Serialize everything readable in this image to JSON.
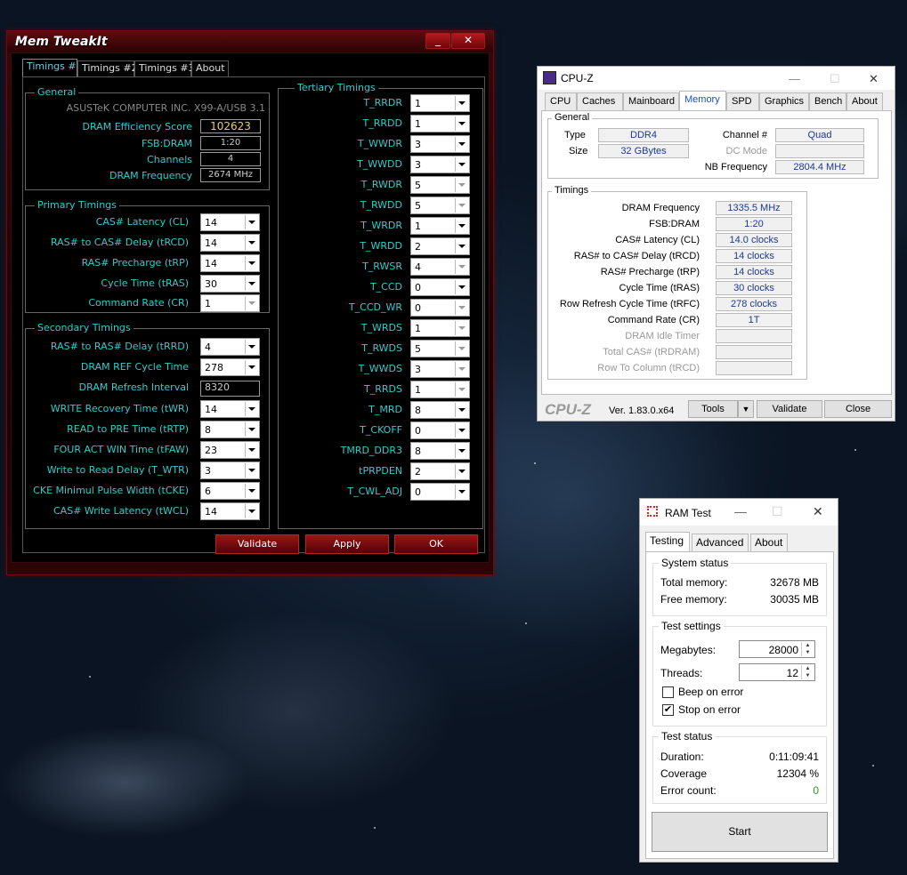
{
  "memtweakit": {
    "title": "Mem TweakIt",
    "min_label": "_",
    "close_label": "✕",
    "tabs": [
      "Timings #1",
      "Timings #2",
      "Timings #3",
      "About"
    ],
    "general": {
      "label": "General",
      "board": "ASUSTeK COMPUTER INC. X99-A/USB 3.1",
      "efficiency_label": "DRAM Efficiency Score",
      "efficiency_value": "102623",
      "fsb_label": "FSB:DRAM",
      "fsb_value": "1:20",
      "channels_label": "Channels",
      "channels_value": "4",
      "freq_label": "DRAM Frequency",
      "freq_value": "2674 MHz"
    },
    "primary": {
      "label": "Primary Timings",
      "rows": [
        {
          "label": "CAS# Latency (CL)",
          "value": "14"
        },
        {
          "label": "RAS# to CAS# Delay (tRCD)",
          "value": "14"
        },
        {
          "label": "RAS# Precharge (tRP)",
          "value": "14"
        },
        {
          "label": "Cycle Time (tRAS)",
          "value": "30"
        },
        {
          "label": "Command Rate (CR)",
          "value": "1"
        }
      ]
    },
    "secondary": {
      "label": "Secondary Timings",
      "rows": [
        {
          "label": "RAS# to RAS# Delay (tRRD)",
          "value": "4"
        },
        {
          "label": "DRAM REF Cycle Time",
          "value": "278"
        },
        {
          "label": "DRAM Refresh Interval",
          "value": "8320"
        },
        {
          "label": "WRITE Recovery Time (tWR)",
          "value": "14"
        },
        {
          "label": "READ to PRE Time (tRTP)",
          "value": "8"
        },
        {
          "label": "FOUR ACT WIN Time (tFAW)",
          "value": "23"
        },
        {
          "label": "Write to Read Delay (T_WTR)",
          "value": "3"
        },
        {
          "label": "CKE Minimul Pulse Width (tCKE)",
          "value": "6"
        },
        {
          "label": "CAS# Write Latency (tWCL)",
          "value": "14"
        }
      ]
    },
    "tertiary": {
      "label": "Tertiary Timings",
      "rows": [
        {
          "label": "T_RRDR",
          "value": "1"
        },
        {
          "label": "T_RRDD",
          "value": "1"
        },
        {
          "label": "T_WWDR",
          "value": "3"
        },
        {
          "label": "T_WWDD",
          "value": "3"
        },
        {
          "label": "T_RWDR",
          "value": "5"
        },
        {
          "label": "T_RWDD",
          "value": "5"
        },
        {
          "label": "T_WRDR",
          "value": "1"
        },
        {
          "label": "T_WRDD",
          "value": "2"
        },
        {
          "label": "T_RWSR",
          "value": "4"
        },
        {
          "label": "T_CCD",
          "value": "0"
        },
        {
          "label": "T_CCD_WR",
          "value": "0"
        },
        {
          "label": "T_WRDS",
          "value": "1"
        },
        {
          "label": "T_RWDS",
          "value": "5"
        },
        {
          "label": "T_WWDS",
          "value": "3"
        },
        {
          "label": "T_RRDS",
          "value": "1"
        },
        {
          "label": "T_MRD",
          "value": "8"
        },
        {
          "label": "T_CKOFF",
          "value": "0"
        },
        {
          "label": "TMRD_DDR3",
          "value": "8"
        },
        {
          "label": "tPRPDEN",
          "value": "2"
        },
        {
          "label": "T_CWL_ADJ",
          "value": "0"
        }
      ]
    },
    "buttons": {
      "validate": "Validate",
      "apply": "Apply",
      "ok": "OK"
    }
  },
  "cpuz": {
    "title": "CPU-Z",
    "tabs": [
      "CPU",
      "Caches",
      "Mainboard",
      "Memory",
      "SPD",
      "Graphics",
      "Bench",
      "About"
    ],
    "general": {
      "label": "General",
      "type_label": "Type",
      "type_value": "DDR4",
      "size_label": "Size",
      "size_value": "32 GBytes",
      "channel_label": "Channel #",
      "channel_value": "Quad",
      "dcmode_label": "DC Mode",
      "dcmode_value": "",
      "nb_label": "NB Frequency",
      "nb_value": "2804.4 MHz"
    },
    "timings": {
      "label": "Timings",
      "rows": [
        {
          "label": "DRAM Frequency",
          "value": "1335.5 MHz"
        },
        {
          "label": "FSB:DRAM",
          "value": "1:20"
        },
        {
          "label": "CAS# Latency (CL)",
          "value": "14.0 clocks"
        },
        {
          "label": "RAS# to CAS# Delay (tRCD)",
          "value": "14 clocks"
        },
        {
          "label": "RAS# Precharge (tRP)",
          "value": "14 clocks"
        },
        {
          "label": "Cycle Time (tRAS)",
          "value": "30 clocks"
        },
        {
          "label": "Row Refresh Cycle Time (tRFC)",
          "value": "278 clocks"
        },
        {
          "label": "Command Rate (CR)",
          "value": "1T"
        },
        {
          "label": "DRAM Idle Timer",
          "value": ""
        },
        {
          "label": "Total CAS# (tRDRAM)",
          "value": ""
        },
        {
          "label": "Row To Column (tRCD)",
          "value": ""
        }
      ]
    },
    "logo": "CPU-Z",
    "version": "Ver. 1.83.0.x64",
    "tools": "Tools",
    "validate": "Validate",
    "close": "Close"
  },
  "ramtest": {
    "title": "RAM Test",
    "tabs": [
      "Testing",
      "Advanced",
      "About"
    ],
    "system": {
      "label": "System status",
      "total_label": "Total memory:",
      "total_value": "32678 MB",
      "free_label": "Free memory:",
      "free_value": "30035 MB"
    },
    "settings": {
      "label": "Test settings",
      "mb_label": "Megabytes:",
      "mb_value": "28000",
      "threads_label": "Threads:",
      "threads_value": "12",
      "beep_label": "Beep on error",
      "beep_checked": false,
      "stop_label": "Stop on error",
      "stop_checked": true
    },
    "status": {
      "label": "Test status",
      "duration_label": "Duration:",
      "duration_value": "0:11:09:41",
      "coverage_label": "Coverage",
      "coverage_value": "12304 %",
      "errors_label": "Error count:",
      "errors_value": "0",
      "error_color": "#2a9a2a"
    },
    "start": "Start"
  }
}
